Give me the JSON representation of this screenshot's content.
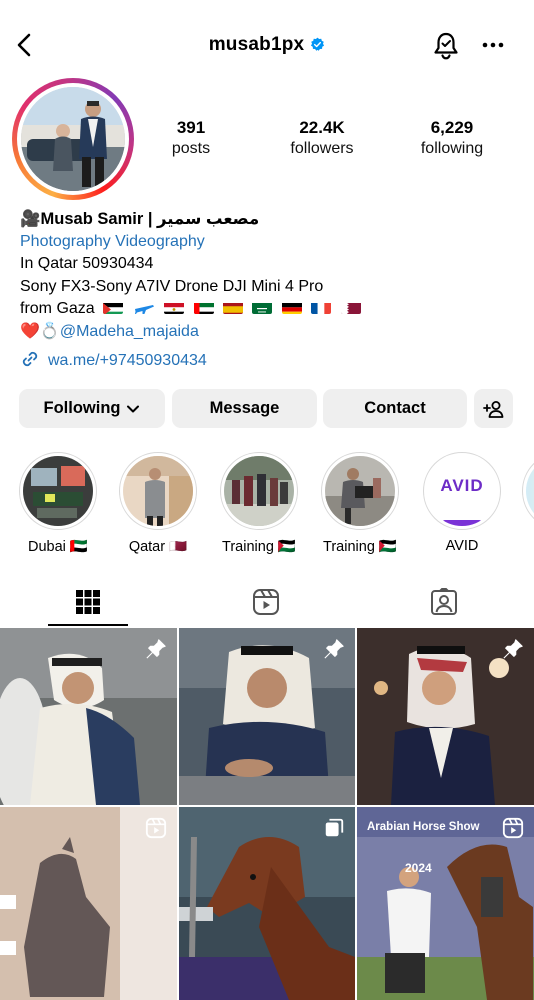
{
  "header": {
    "username": "musab1px",
    "icons": [
      "back-arrow-icon",
      "verified-badge-icon",
      "notification-bell-icon",
      "more-icon"
    ]
  },
  "stats": [
    {
      "value": "391",
      "label": "posts"
    },
    {
      "value": "22.4K",
      "label": "followers"
    },
    {
      "value": "6,229",
      "label": "following"
    }
  ],
  "bio": {
    "name": "🎥Musab Samir | مصعب سمير",
    "category": "Photography Videography",
    "line1": "In Qatar 50930434",
    "line2": "Sony FX3-Sony A7IV Drone DJI Mini 4 Pro",
    "line3_prefix": "from Gaza",
    "line4_emoji": "❤️💍",
    "mention": "@Madeha_majaida",
    "link": "wa.me/+97450930434"
  },
  "buttons": {
    "following": "Following",
    "message": "Message",
    "contact": "Contact"
  },
  "highlights": [
    {
      "label": "Dubai 🇦🇪"
    },
    {
      "label": "Qatar 🇶🇦"
    },
    {
      "label": "Training 🇵🇸"
    },
    {
      "label": "Training 🇵🇸"
    },
    {
      "label": "AVID"
    }
  ],
  "highlight_logo_text": "AVID",
  "tabs": [
    "grid-tab",
    "reels-tab",
    "tagged-tab"
  ],
  "grid_overlay_text": {
    "post5_banner": "Arabian Horse Show",
    "post5_year": "2024"
  },
  "colors": {
    "link_blue": "#2572b7",
    "button_grey": "#efefef",
    "verified_blue": "#0095f6"
  }
}
